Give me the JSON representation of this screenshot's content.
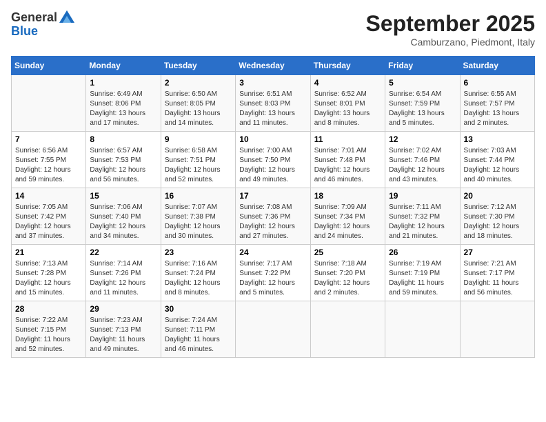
{
  "logo": {
    "general": "General",
    "blue": "Blue"
  },
  "title": "September 2025",
  "location": "Camburzano, Piedmont, Italy",
  "weekdays": [
    "Sunday",
    "Monday",
    "Tuesday",
    "Wednesday",
    "Thursday",
    "Friday",
    "Saturday"
  ],
  "weeks": [
    [
      {
        "day": "",
        "sunrise": "",
        "sunset": "",
        "daylight": ""
      },
      {
        "day": "1",
        "sunrise": "Sunrise: 6:49 AM",
        "sunset": "Sunset: 8:06 PM",
        "daylight": "Daylight: 13 hours and 17 minutes."
      },
      {
        "day": "2",
        "sunrise": "Sunrise: 6:50 AM",
        "sunset": "Sunset: 8:05 PM",
        "daylight": "Daylight: 13 hours and 14 minutes."
      },
      {
        "day": "3",
        "sunrise": "Sunrise: 6:51 AM",
        "sunset": "Sunset: 8:03 PM",
        "daylight": "Daylight: 13 hours and 11 minutes."
      },
      {
        "day": "4",
        "sunrise": "Sunrise: 6:52 AM",
        "sunset": "Sunset: 8:01 PM",
        "daylight": "Daylight: 13 hours and 8 minutes."
      },
      {
        "day": "5",
        "sunrise": "Sunrise: 6:54 AM",
        "sunset": "Sunset: 7:59 PM",
        "daylight": "Daylight: 13 hours and 5 minutes."
      },
      {
        "day": "6",
        "sunrise": "Sunrise: 6:55 AM",
        "sunset": "Sunset: 7:57 PM",
        "daylight": "Daylight: 13 hours and 2 minutes."
      }
    ],
    [
      {
        "day": "7",
        "sunrise": "Sunrise: 6:56 AM",
        "sunset": "Sunset: 7:55 PM",
        "daylight": "Daylight: 12 hours and 59 minutes."
      },
      {
        "day": "8",
        "sunrise": "Sunrise: 6:57 AM",
        "sunset": "Sunset: 7:53 PM",
        "daylight": "Daylight: 12 hours and 56 minutes."
      },
      {
        "day": "9",
        "sunrise": "Sunrise: 6:58 AM",
        "sunset": "Sunset: 7:51 PM",
        "daylight": "Daylight: 12 hours and 52 minutes."
      },
      {
        "day": "10",
        "sunrise": "Sunrise: 7:00 AM",
        "sunset": "Sunset: 7:50 PM",
        "daylight": "Daylight: 12 hours and 49 minutes."
      },
      {
        "day": "11",
        "sunrise": "Sunrise: 7:01 AM",
        "sunset": "Sunset: 7:48 PM",
        "daylight": "Daylight: 12 hours and 46 minutes."
      },
      {
        "day": "12",
        "sunrise": "Sunrise: 7:02 AM",
        "sunset": "Sunset: 7:46 PM",
        "daylight": "Daylight: 12 hours and 43 minutes."
      },
      {
        "day": "13",
        "sunrise": "Sunrise: 7:03 AM",
        "sunset": "Sunset: 7:44 PM",
        "daylight": "Daylight: 12 hours and 40 minutes."
      }
    ],
    [
      {
        "day": "14",
        "sunrise": "Sunrise: 7:05 AM",
        "sunset": "Sunset: 7:42 PM",
        "daylight": "Daylight: 12 hours and 37 minutes."
      },
      {
        "day": "15",
        "sunrise": "Sunrise: 7:06 AM",
        "sunset": "Sunset: 7:40 PM",
        "daylight": "Daylight: 12 hours and 34 minutes."
      },
      {
        "day": "16",
        "sunrise": "Sunrise: 7:07 AM",
        "sunset": "Sunset: 7:38 PM",
        "daylight": "Daylight: 12 hours and 30 minutes."
      },
      {
        "day": "17",
        "sunrise": "Sunrise: 7:08 AM",
        "sunset": "Sunset: 7:36 PM",
        "daylight": "Daylight: 12 hours and 27 minutes."
      },
      {
        "day": "18",
        "sunrise": "Sunrise: 7:09 AM",
        "sunset": "Sunset: 7:34 PM",
        "daylight": "Daylight: 12 hours and 24 minutes."
      },
      {
        "day": "19",
        "sunrise": "Sunrise: 7:11 AM",
        "sunset": "Sunset: 7:32 PM",
        "daylight": "Daylight: 12 hours and 21 minutes."
      },
      {
        "day": "20",
        "sunrise": "Sunrise: 7:12 AM",
        "sunset": "Sunset: 7:30 PM",
        "daylight": "Daylight: 12 hours and 18 minutes."
      }
    ],
    [
      {
        "day": "21",
        "sunrise": "Sunrise: 7:13 AM",
        "sunset": "Sunset: 7:28 PM",
        "daylight": "Daylight: 12 hours and 15 minutes."
      },
      {
        "day": "22",
        "sunrise": "Sunrise: 7:14 AM",
        "sunset": "Sunset: 7:26 PM",
        "daylight": "Daylight: 12 hours and 11 minutes."
      },
      {
        "day": "23",
        "sunrise": "Sunrise: 7:16 AM",
        "sunset": "Sunset: 7:24 PM",
        "daylight": "Daylight: 12 hours and 8 minutes."
      },
      {
        "day": "24",
        "sunrise": "Sunrise: 7:17 AM",
        "sunset": "Sunset: 7:22 PM",
        "daylight": "Daylight: 12 hours and 5 minutes."
      },
      {
        "day": "25",
        "sunrise": "Sunrise: 7:18 AM",
        "sunset": "Sunset: 7:20 PM",
        "daylight": "Daylight: 12 hours and 2 minutes."
      },
      {
        "day": "26",
        "sunrise": "Sunrise: 7:19 AM",
        "sunset": "Sunset: 7:19 PM",
        "daylight": "Daylight: 11 hours and 59 minutes."
      },
      {
        "day": "27",
        "sunrise": "Sunrise: 7:21 AM",
        "sunset": "Sunset: 7:17 PM",
        "daylight": "Daylight: 11 hours and 56 minutes."
      }
    ],
    [
      {
        "day": "28",
        "sunrise": "Sunrise: 7:22 AM",
        "sunset": "Sunset: 7:15 PM",
        "daylight": "Daylight: 11 hours and 52 minutes."
      },
      {
        "day": "29",
        "sunrise": "Sunrise: 7:23 AM",
        "sunset": "Sunset: 7:13 PM",
        "daylight": "Daylight: 11 hours and 49 minutes."
      },
      {
        "day": "30",
        "sunrise": "Sunrise: 7:24 AM",
        "sunset": "Sunset: 7:11 PM",
        "daylight": "Daylight: 11 hours and 46 minutes."
      },
      {
        "day": "",
        "sunrise": "",
        "sunset": "",
        "daylight": ""
      },
      {
        "day": "",
        "sunrise": "",
        "sunset": "",
        "daylight": ""
      },
      {
        "day": "",
        "sunrise": "",
        "sunset": "",
        "daylight": ""
      },
      {
        "day": "",
        "sunrise": "",
        "sunset": "",
        "daylight": ""
      }
    ]
  ]
}
